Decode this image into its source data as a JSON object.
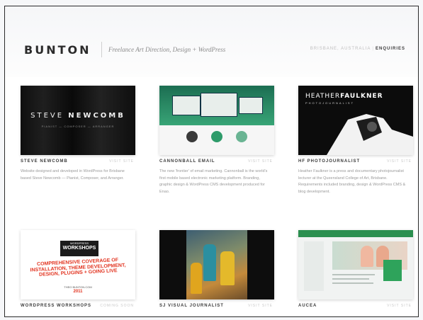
{
  "brand": {
    "logo": "BUNTON",
    "tagline": "Freelance Art Direction, Design + WordPress"
  },
  "nav": {
    "location": "BRISBANE, AUSTRALIA",
    "enquiries": "ENQUIRIES"
  },
  "projects": [
    {
      "title": "STEVE NEWCOMB",
      "visit": "VISIT SITE",
      "description": "Website designed and developed in WordPress for Brisbane based Steve Newcomb — Pianist, Composer, and Arranger.",
      "thumb": {
        "name_first": "STEVE",
        "name_last": "NEWCOMB",
        "roles": "PIANIST — COMPOSER — ARRANGER"
      }
    },
    {
      "title": "CANNONBALL EMAIL",
      "visit": "VISIT SITE",
      "description": "The new 'frontier' of email marketing. Cannonball is the world's first mobile based electronic marketing platform. Branding, graphic design & WordPress CMS development produced for Enao."
    },
    {
      "title": "HF PHOTOJOURNALIST",
      "visit": "VISIT SITE",
      "description": "Heather Faulkner is a press and documentary photojournalist lecturer at the Queensland College of Art, Brisbane. Requirements included branding, design & WordPress CMS & blog development.",
      "thumb": {
        "heading_first": "HEATHER",
        "heading_last": "FAULKNER",
        "subheading": "PHOTOJOURNALIST"
      }
    },
    {
      "title": "WORDPRESS WORKSHOPS",
      "visit": "COMING SOON",
      "thumb": {
        "badge_small": "WORDPRESS",
        "badge_big": "WORKSHOPS",
        "red_text": "COMPREHENSIVE COVERAGE OF INSTALLATION, THEME DEVELOPMENT, DESIGN, PLUGINS + GOING LIVE",
        "footer": "THEO BUNTON.COM",
        "year": "2011"
      }
    },
    {
      "title": "SJ VISUAL JOURNALIST",
      "visit": "VISIT SITE"
    },
    {
      "title": "AUCEA",
      "visit": "VISIT SITE"
    }
  ]
}
